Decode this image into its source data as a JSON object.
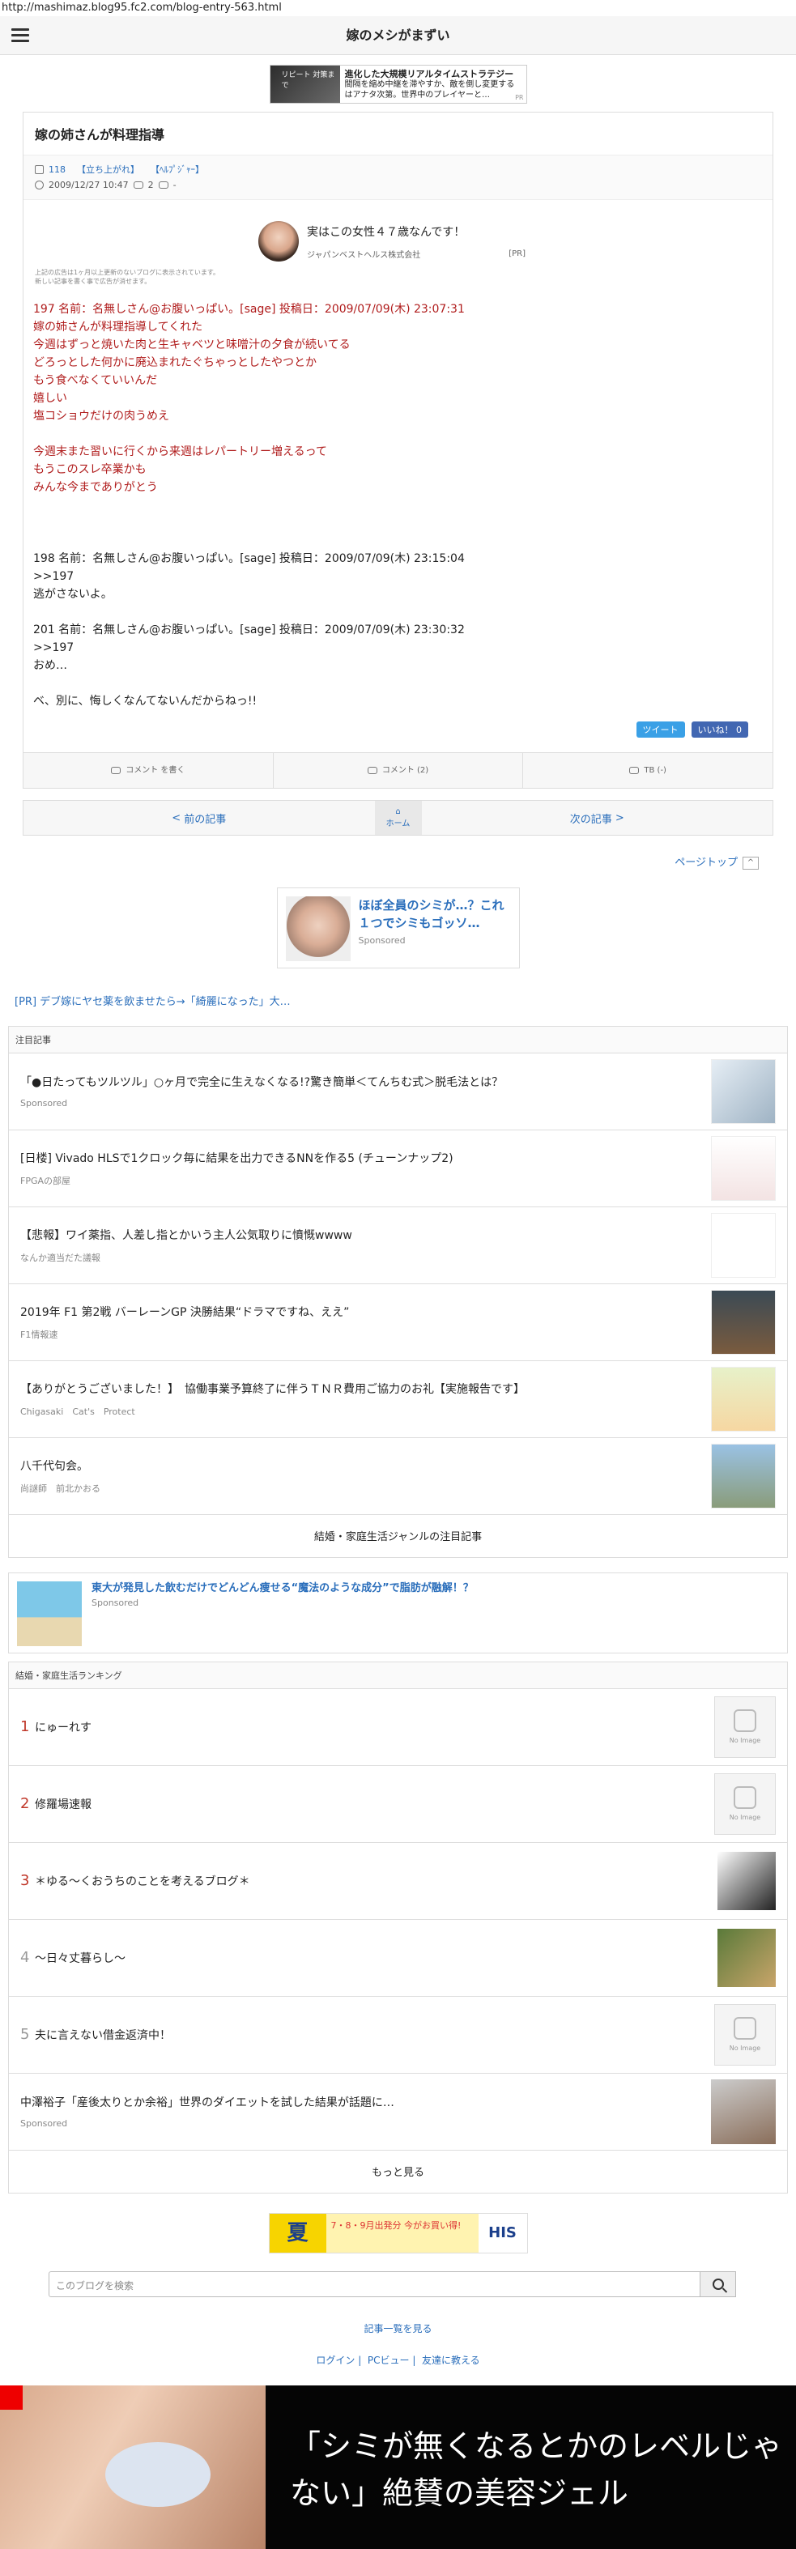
{
  "url": "http://mashimaz.blog95.fc2.com/blog-entry-563.html",
  "site_title": "嫁のメシがまずい",
  "top_ad": {
    "thumb": "リピート 対策まで",
    "title": "進化した大規模リアルタイムストラテジー",
    "text": "間隔を縮め中継を滞やすか、敵を倒し変更するはアナタ次第。世界中のプレイヤーと…",
    "tag": "PR"
  },
  "article": {
    "title": "嫁の姉さんが料理指導",
    "views": "118",
    "tag1": "【立ち上がれ】",
    "tag2": "【ﾍﾙﾌﾟｼﾞｬｰ】",
    "date": "2009/12/27 10:47",
    "comments": "2",
    "tb": "-",
    "pr_title": "実はこの女性４７歳なんです！",
    "pr_sub": "ジャパンベストヘルス株式会社",
    "pr_mark": "[PR]",
    "notice1": "上記の広告は1ヶ月以上更新のないブログに表示されています。",
    "notice2": "新しい記事を書く事で広告が消せます。",
    "red_lines": [
      "197 名前：名無しさん@お腹いっぱい。[sage] 投稿日：2009/07/09(木) 23:07:31",
      "嫁の姉さんが料理指導してくれた",
      "今週はずっと焼いた肉と生キャベツと味噌汁の夕食が続いてる",
      "どろっとした何かに廃込まれたぐちゃっとしたやつとか",
      "もう食べなくていいんだ",
      "嬉しい",
      "塩コショウだけの肉うめえ",
      "",
      "今週末また習いに行くから来週はレパートリー増えるって",
      "もうこのスレ卒業かも",
      "みんな今までありがとう"
    ],
    "black_lines": [
      "198 名前：名無しさん@お腹いっぱい。[sage] 投稿日：2009/07/09(木) 23:15:04",
      ">>197",
      "逃がさないよ。",
      "",
      "201 名前：名無しさん@お腹いっぱい。[sage] 投稿日：2009/07/09(木) 23:30:32",
      ">>197",
      "おめ…",
      "",
      "ベ、別に、悔しくなんてないんだからねっ!!"
    ],
    "tweet": "ツイート",
    "like": "いいね！ 0",
    "act_comment_write": "コメント を書く",
    "act_comment_count": "コメント (2)",
    "act_tb": "TB (-)"
  },
  "nav": {
    "prev": "前の記事",
    "home": "ホーム",
    "next": "次の記事"
  },
  "pagetop": "ページトップ",
  "spon1": {
    "title": "ほぼ全員のシミが…？これ１つでシミもゴッソ…",
    "label": "Sponsored"
  },
  "pr_link": "[PR] デブ嫁にヤセ薬を飲ませたら→「綺麗になった」大…",
  "attention": {
    "head": "注目記事",
    "items": [
      {
        "title": "「●日たってもツルツル」○ヶ月で完全に生えなくなる!?驚き簡単＜てんちむ式＞脱毛法とは？",
        "sub": "Sponsored"
      },
      {
        "title": "[日楼] Vivado HLSで1クロック毎に結果を出力できるNNを作る5 (チューンナップ2)",
        "sub": "FPGAの部屋"
      },
      {
        "title": "【悲報】ワイ薬指、人差し指とかいう主人公気取りに憤慨wwww",
        "sub": "なんか適当だた議報"
      },
      {
        "title": "2019年 F1 第2戦 バーレーンGP 決勝結果“ドラマですね、ええ”",
        "sub": "F1情報速"
      },
      {
        "title": "【ありがとうございました！】　協働事業予算終了に伴うＴＮＲ費用ご協力のお礼【実施報告です】",
        "sub": "Chigasaki　Cat's　Protect"
      },
      {
        "title": "八千代句会。",
        "sub": "尚謎師　前北かおる"
      }
    ],
    "more": "結婚・家庭生活ジャンルの注目記事"
  },
  "spon2": {
    "title": "東大が発見した飲むだけでどんどん痩せる“魔法のような成分”で脂肪が融解！？",
    "label": "Sponsored"
  },
  "ranking": {
    "head": "結婚・家庭生活ランキング",
    "items": [
      {
        "n": "1",
        "title": "にゅーれす"
      },
      {
        "n": "2",
        "title": "修羅場速報"
      },
      {
        "n": "3",
        "title": "＊ゆる～くおうちのことを考えるブログ＊"
      },
      {
        "n": "4",
        "title": "～日々丈暮らし～"
      },
      {
        "n": "5",
        "title": "夫に言えない借金返済中！"
      }
    ],
    "noimage": "No Image",
    "extra_title": "中澤裕子「産後太りとか余裕」世界のダイエットを試した結果が話題に…",
    "extra_sub": "Sponsored",
    "more": "もっと見る"
  },
  "banner": {
    "l": "夏",
    "m": "7・8・9月出発分 今がお買い得!",
    "r": "HIS"
  },
  "search_placeholder": "このブログを検索",
  "links": {
    "list": "記事一覧を見る",
    "login": "ログイン",
    "pc": "PCビュー",
    "friend": "友達に教える",
    "sep": "|"
  },
  "bottom_ad": "「シミが無くなるとかのレベルじゃない」絶賛の美容ジェル"
}
